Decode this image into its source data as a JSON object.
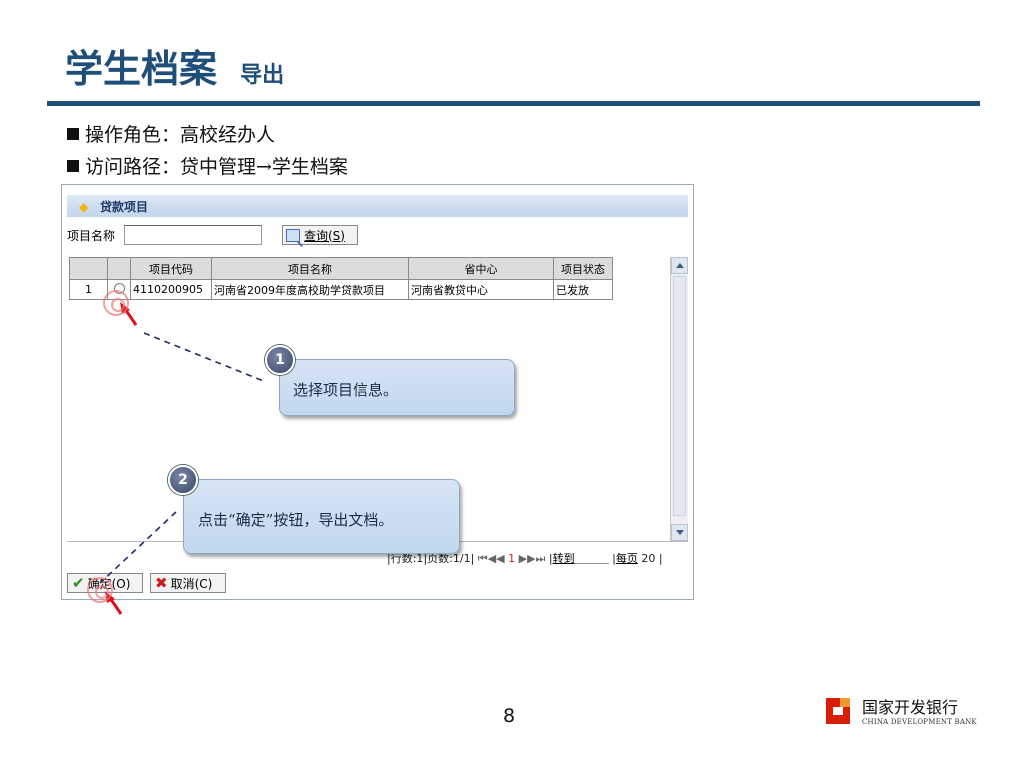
{
  "slide": {
    "title": "学生档案",
    "subtitle": "导出",
    "bullets": [
      "操作角色：高校经办人",
      "访问路径：贷中管理→学生档案"
    ],
    "page_number": "8"
  },
  "app": {
    "panel_title": "贷款项目",
    "search": {
      "label": "项目名称",
      "value": "",
      "button": "查询(S)"
    },
    "table": {
      "columns": [
        "",
        "",
        "项目代码",
        "项目名称",
        "省中心",
        "项目状态"
      ],
      "rows": [
        {
          "index": "1",
          "code": "4110200905",
          "name": "河南省2009年度高校助学贷款项目",
          "center": "河南省教贷中心",
          "status": "已发放"
        }
      ]
    },
    "pager": {
      "rows_label": "行数:1",
      "pages_label": "页数:1/1",
      "current_page": "1",
      "goto": "转到",
      "per_page_label": "每页",
      "per_page_value": "20"
    },
    "buttons": {
      "confirm": "确定(O)",
      "cancel": "取消(C)"
    }
  },
  "callouts": [
    {
      "number": "1",
      "text": "选择项目信息。"
    },
    {
      "number": "2",
      "text": "点击“确定”按钮，导出文档。"
    }
  ],
  "logo": {
    "cn": "国家开发银行",
    "en": "CHINA DEVELOPMENT BANK"
  },
  "colors": {
    "title": "#1f4e79",
    "rule": "#1f4e79",
    "accent_red": "#d81e06"
  }
}
